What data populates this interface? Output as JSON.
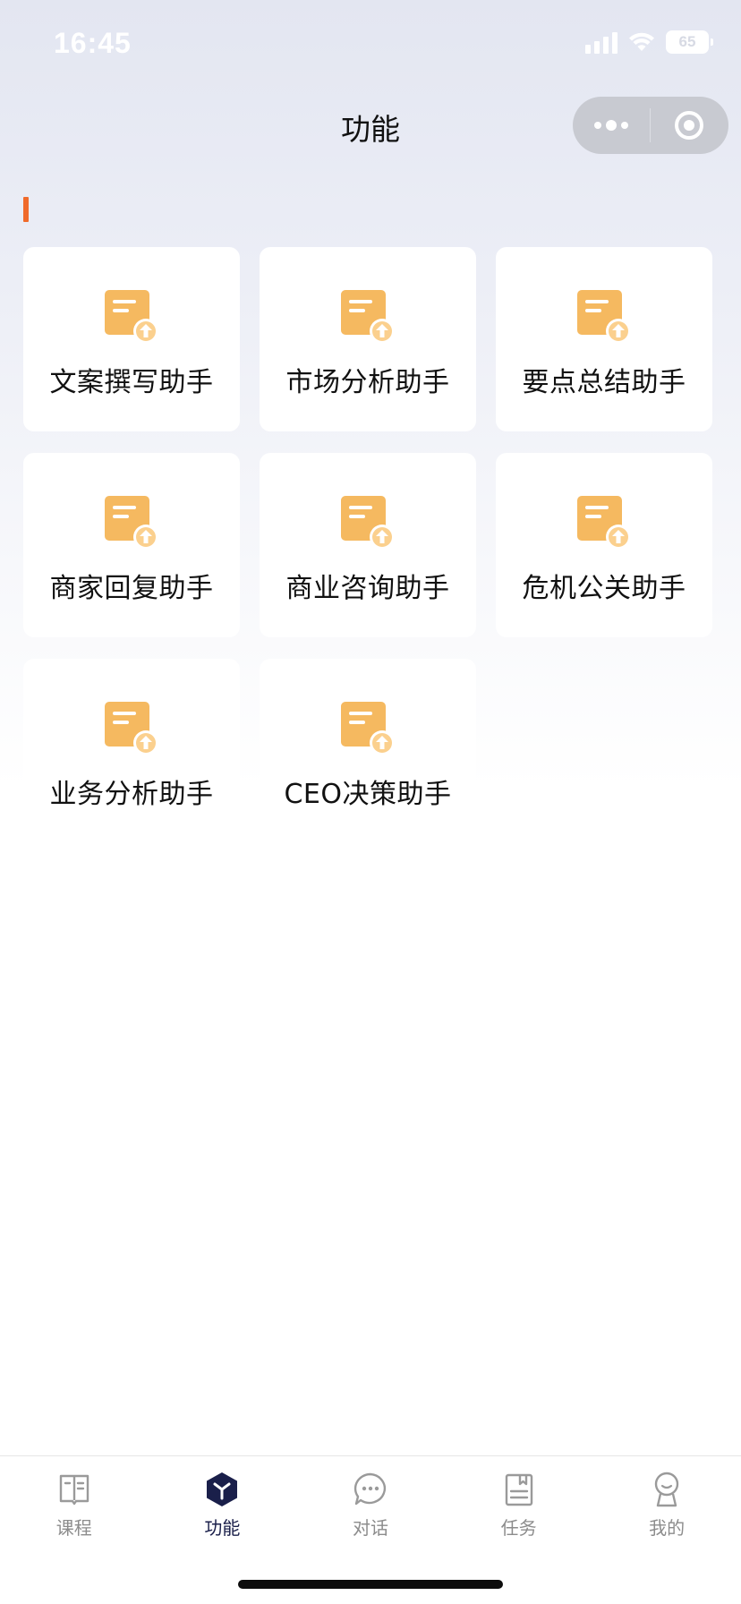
{
  "status_bar": {
    "time": "16:45",
    "battery": "65",
    "icons": [
      "signal-icon",
      "wifi-icon",
      "battery-icon"
    ]
  },
  "nav": {
    "title": "功能",
    "capsule": {
      "more_icon": "more-dots-icon",
      "close_icon": "target-circle-icon"
    }
  },
  "accent_color": "#f06a2a",
  "icon_color": "#f5b960",
  "functions": [
    {
      "label": "文案撰写助手",
      "icon": "document-upload-icon"
    },
    {
      "label": "市场分析助手",
      "icon": "document-upload-icon"
    },
    {
      "label": "要点总结助手",
      "icon": "document-upload-icon"
    },
    {
      "label": "商家回复助手",
      "icon": "document-upload-icon"
    },
    {
      "label": "商业咨询助手",
      "icon": "document-upload-icon"
    },
    {
      "label": "危机公关助手",
      "icon": "document-upload-icon"
    },
    {
      "label": "业务分析助手",
      "icon": "document-upload-icon"
    },
    {
      "label": "CEO决策助手",
      "icon": "document-upload-icon"
    }
  ],
  "tab_bar": {
    "active_index": 1,
    "tabs": [
      {
        "label": "课程",
        "icon": "book-icon"
      },
      {
        "label": "功能",
        "icon": "cube-icon"
      },
      {
        "label": "对话",
        "icon": "chat-bubble-icon"
      },
      {
        "label": "任务",
        "icon": "clipboard-icon"
      },
      {
        "label": "我的",
        "icon": "user-icon"
      }
    ]
  }
}
